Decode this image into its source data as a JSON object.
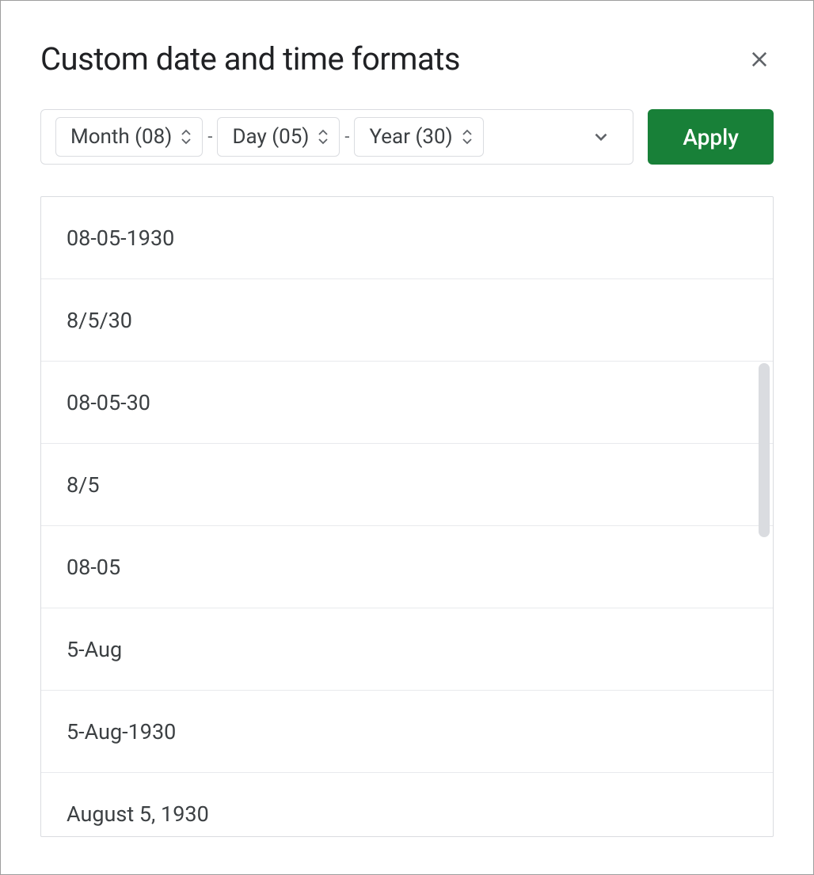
{
  "dialog": {
    "title": "Custom date and time formats",
    "apply_label": "Apply"
  },
  "builder": {
    "chips": [
      {
        "label": "Month (08)"
      },
      {
        "label": "Day (05)"
      },
      {
        "label": "Year (30)"
      }
    ],
    "separator": "-"
  },
  "formats": [
    "08-05-1930",
    "8/5/30",
    "08-05-30",
    "8/5",
    "08-05",
    "5-Aug",
    "5-Aug-1930",
    "August 5, 1930"
  ]
}
